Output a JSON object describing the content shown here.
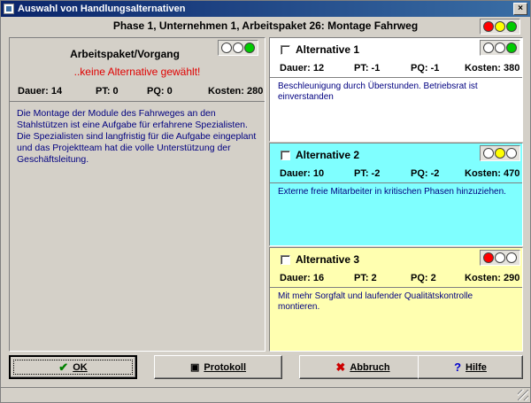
{
  "window": {
    "title": "Auswahl von Handlungsalternativen",
    "close_label": "×"
  },
  "phase_title": "Phase 1, Unternehmen 1, Arbeitspaket 26: Montage Fahrweg",
  "header_lights": [
    "red",
    "yellow",
    "green"
  ],
  "left": {
    "heading": "Arbeitspaket/Vorgang",
    "no_alternative": "..keine Alternative gewählt!",
    "lights": [
      "off",
      "off",
      "green"
    ],
    "stats": {
      "dauer": "Dauer: 14",
      "pt": "PT: 0",
      "pq": "PQ: 0",
      "kosten": "Kosten: 280"
    },
    "description": "Die Montage der Module des Fahrweges an den Stahlstützen ist eine Aufgabe für erfahrene Spezialisten. Die Spezialisten sind langfristig für die Aufgabe eingeplant und das Projektteam hat die volle Unterstützung der Geschäftsleitung."
  },
  "alternatives": [
    {
      "title": "Alternative 1",
      "lights": [
        "off",
        "off",
        "green"
      ],
      "dauer": "Dauer: 12",
      "pt": "PT: -1",
      "pq": "PQ: -1",
      "kosten": "Kosten: 380",
      "description": "Beschleunigung durch Überstunden. Betriebsrat ist einverstanden",
      "bg": "#ffffff"
    },
    {
      "title": "Alternative 2",
      "lights": [
        "off",
        "yellow",
        "off"
      ],
      "dauer": "Dauer: 10",
      "pt": "PT: -2",
      "pq": "PQ: -2",
      "kosten": "Kosten: 470",
      "description": "Externe freie Mitarbeiter in kritischen Phasen hinzuziehen.",
      "bg": "#7fffff"
    },
    {
      "title": "Alternative 3",
      "lights": [
        "red",
        "off",
        "off"
      ],
      "dauer": "Dauer: 16",
      "pt": "PT: 2",
      "pq": "PQ: 2",
      "kosten": "Kosten: 290",
      "description": "Mit mehr Sorgfalt und laufender Qualitätskontrolle montieren.",
      "bg": "#ffffb0"
    }
  ],
  "buttons": {
    "ok": "OK",
    "protokoll": "Protokoll",
    "abbruch": "Abbruch",
    "hilfe": "Hilfe"
  }
}
